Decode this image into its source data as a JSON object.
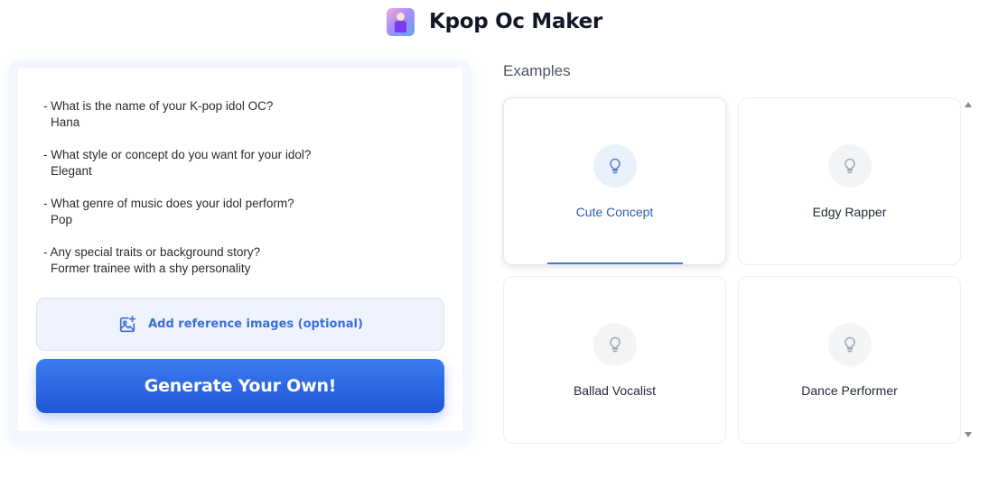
{
  "header": {
    "title": "Kpop Oc Maker",
    "icon": "app-logo-idol-icon"
  },
  "form": {
    "items": [
      {
        "question": "- What is the name of your K-pop idol OC?",
        "answer": "Hana"
      },
      {
        "question": "- What style or concept do you want for your idol?",
        "answer": "Elegant"
      },
      {
        "question": "- What genre of music does your idol perform?",
        "answer": "Pop"
      },
      {
        "question": "- Any special traits or background story?",
        "answer": "Former trainee with a shy personality"
      }
    ],
    "reference_button": {
      "label": "Add reference images (optional)",
      "icon": "image-add-icon"
    },
    "generate_button": {
      "label": "Generate Your Own!"
    }
  },
  "examples": {
    "title": "Examples",
    "cards": [
      {
        "label": "Cute Concept",
        "icon": "lightbulb-icon",
        "selected": true
      },
      {
        "label": "Edgy Rapper",
        "icon": "lightbulb-icon",
        "selected": false
      },
      {
        "label": "Ballad Vocalist",
        "icon": "lightbulb-icon",
        "selected": false
      },
      {
        "label": "Dance Performer",
        "icon": "lightbulb-icon",
        "selected": false
      }
    ]
  },
  "colors": {
    "accent": "#2563eb",
    "accent_light": "#eef3fd",
    "selected_text": "#2e5fa8"
  }
}
